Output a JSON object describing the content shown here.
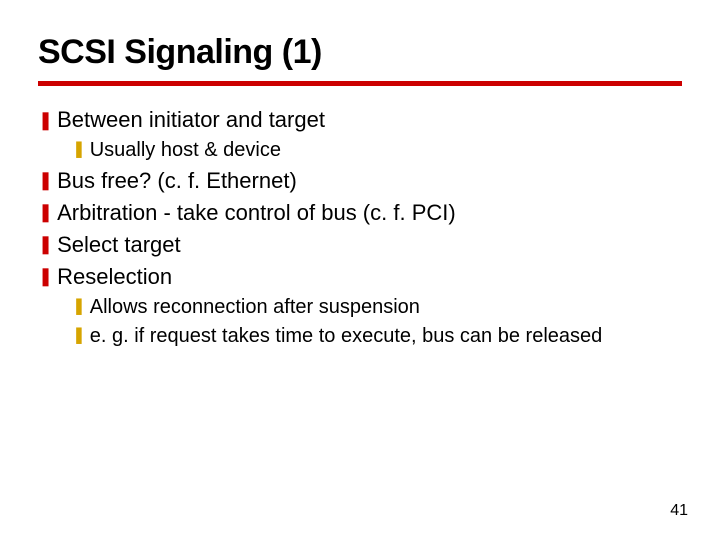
{
  "slide": {
    "title": "SCSI Signaling (1)",
    "page_number": "41",
    "bullets": {
      "b1": "Between initiator and target",
      "b1_1": "Usually host & device",
      "b2": "Bus free?  (c. f. Ethernet)",
      "b3": "Arbitration - take control of bus (c. f. PCI)",
      "b4": "Select target",
      "b5": "Reselection",
      "b5_1": "Allows reconnection after suspension",
      "b5_2": "e. g. if request takes time to execute, bus can be released"
    },
    "glyphs": {
      "main": "❚",
      "sub": "❚"
    }
  }
}
